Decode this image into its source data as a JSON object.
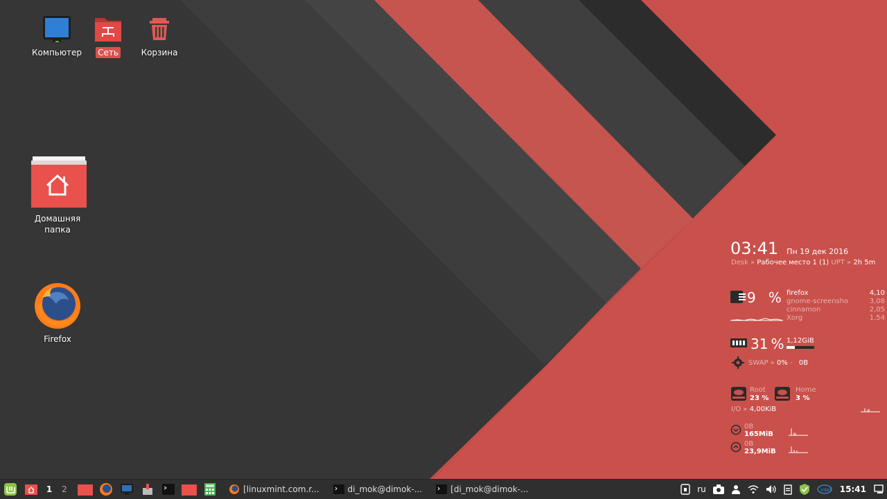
{
  "desktop": {
    "icons": [
      {
        "name": "computer",
        "label": "Компьютер"
      },
      {
        "name": "network",
        "label": "Сеть"
      },
      {
        "name": "trash",
        "label": "Корзина"
      },
      {
        "name": "home",
        "label": "Домашняя папка"
      },
      {
        "name": "firefox",
        "label": "Firefox"
      }
    ]
  },
  "conky": {
    "time": "03:41",
    "date": "Пн 19 дек 2016",
    "desk_label": "Desk",
    "desk_value": "Рабочее место 1 (1)",
    "upt_label": "UPT",
    "upt_value": "2h 5m",
    "cpu_value": "9",
    "cpu_unit": "%",
    "processes": [
      {
        "name": "firefox",
        "value": "4,10"
      },
      {
        "name": "gnome-screensho",
        "value": "3,08"
      },
      {
        "name": "cinnamon",
        "value": "2,05"
      },
      {
        "name": "Xorg",
        "value": "1,54"
      }
    ],
    "ram_value": "31",
    "ram_unit": "%",
    "ram_used": "1,12GiB",
    "ram_fraction": 0.31,
    "swap_label": "SWAP",
    "swap_percent": "0%",
    "swap_size": "0B",
    "root_label": "Root",
    "root_value": "23 %",
    "home_label": "Home",
    "home_value": "3 %",
    "io_label": "I/O",
    "io_value": "4,00KiB",
    "down_rate": "0B",
    "down_total": "165MiB",
    "up_rate": "0B",
    "up_total": "23,9MiB"
  },
  "taskbar": {
    "workspaces": [
      "1",
      "2"
    ],
    "tasks": [
      {
        "name": "firefox-task",
        "label": "[linuxmint.com.r..."
      },
      {
        "name": "terminal-task-1",
        "label": "di_mok@dimok-..."
      },
      {
        "name": "terminal-task-2",
        "label": "[di_mok@dimok-..."
      }
    ],
    "keyboard_layout": "ru",
    "clock": "15:41"
  },
  "colors": {
    "accent": "#e05a55",
    "dark": "#3a3a3a",
    "panel": "#2f2f2f"
  }
}
